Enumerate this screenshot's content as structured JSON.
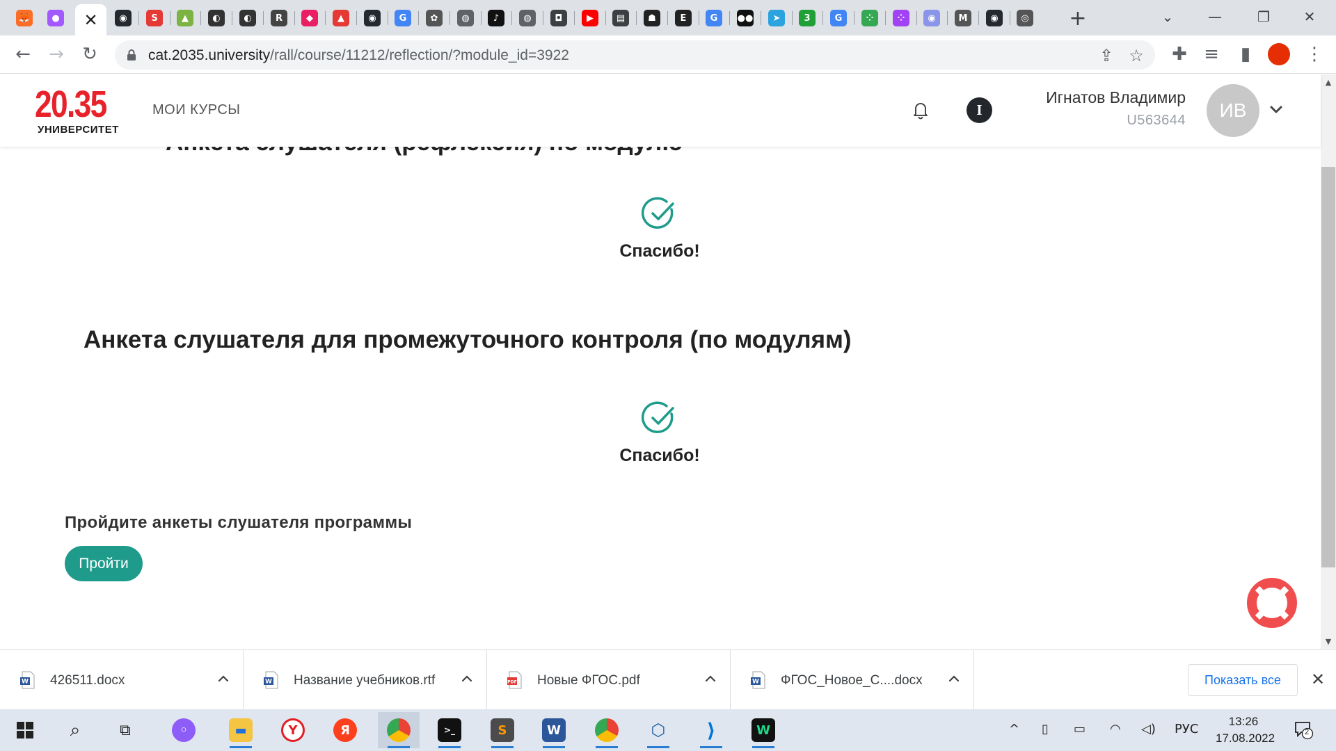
{
  "browser": {
    "tab_icons": [
      {
        "name": "gitlab-icon",
        "glyph": "🦊",
        "color": "#fc6d26"
      },
      {
        "name": "figma-icon",
        "glyph": "●",
        "color": "#a259ff"
      },
      {
        "name": "github-icon",
        "glyph": "◉",
        "color": "#24292f"
      },
      {
        "name": "s-app-icon",
        "glyph": "S",
        "color": "#e53935"
      },
      {
        "name": "leaf-icon",
        "glyph": "▲",
        "color": "#7cb342"
      },
      {
        "name": "head-icon",
        "glyph": "◐",
        "color": "#333333"
      },
      {
        "name": "head-icon-2",
        "glyph": "◐",
        "color": "#333333"
      },
      {
        "name": "r-app-icon",
        "glyph": "R",
        "color": "#444444"
      },
      {
        "name": "pink-app-icon",
        "glyph": "◆",
        "color": "#e91e63"
      },
      {
        "name": "flame-icon",
        "glyph": "▲",
        "color": "#e53935"
      },
      {
        "name": "github-icon-2",
        "glyph": "◉",
        "color": "#24292f"
      },
      {
        "name": "google-icon",
        "glyph": "G",
        "color": "#4285f4"
      },
      {
        "name": "openai-icon",
        "glyph": "✿",
        "color": "#555555"
      },
      {
        "name": "globe-icon",
        "glyph": "◍",
        "color": "#5f6368"
      },
      {
        "name": "tiktok-icon",
        "glyph": "♪",
        "color": "#111111"
      },
      {
        "name": "globe-icon-2",
        "glyph": "◍",
        "color": "#5f6368"
      },
      {
        "name": "app-icon",
        "glyph": "◘",
        "color": "#3c4043"
      },
      {
        "name": "youtube-icon",
        "glyph": "▶",
        "color": "#ff0000"
      },
      {
        "name": "book-icon",
        "glyph": "▤",
        "color": "#3c4043"
      },
      {
        "name": "ghost-icon",
        "glyph": "☗",
        "color": "#222222"
      },
      {
        "name": "e-app-icon",
        "glyph": "E",
        "color": "#222222"
      },
      {
        "name": "google-icon-2",
        "glyph": "G",
        "color": "#4285f4"
      },
      {
        "name": "medium-icon",
        "glyph": "●●",
        "color": "#111111"
      },
      {
        "name": "telegram-icon",
        "glyph": "➤",
        "color": "#2aa3df"
      },
      {
        "name": "three-icon",
        "glyph": "3",
        "color": "#21a038"
      },
      {
        "name": "google-icon-3",
        "glyph": "G",
        "color": "#4285f4"
      },
      {
        "name": "dots-icon",
        "glyph": "⁘",
        "color": "#34a853"
      },
      {
        "name": "dots-icon-2",
        "glyph": "⁘",
        "color": "#a142f4"
      },
      {
        "name": "chat-icon",
        "glyph": "◉",
        "color": "#8a94e8"
      },
      {
        "name": "gmail-icon",
        "glyph": "M",
        "color": "#555555"
      },
      {
        "name": "github-icon-3",
        "glyph": "◉",
        "color": "#24292f"
      },
      {
        "name": "chrome-icon",
        "glyph": "◎",
        "color": "#555555"
      }
    ],
    "active_tab_close": "✕",
    "new_tab": "+",
    "url_host": "cat.2035.university",
    "url_path": "/rall/course/11212/reflection/?module_id=3922"
  },
  "header": {
    "logo_number": "20.35",
    "logo_text": "УНИВЕРСИТЕТ",
    "nav_courses": "МОИ КУРСЫ",
    "info_letter": "I",
    "user_name": "Игнатов Владимир",
    "user_id": "U563644",
    "avatar_initials": "ИВ"
  },
  "content": {
    "cut_heading": "Анкета слушателя (рефлексия) по модулю",
    "thanks_1": "Спасибо!",
    "survey_title": "Анкета слушателя для промежуточного контроля (по модулям)",
    "thanks_2": "Спасибо!",
    "prompt": "Пройдите анкеты слушателя программы",
    "go_button": "Пройти",
    "accent_color": "#1f9b8b"
  },
  "downloads": {
    "items": [
      {
        "name": "426511.docx",
        "type": "word"
      },
      {
        "name": "Название учебников.rtf",
        "type": "word"
      },
      {
        "name": "Новые ФГОС.pdf",
        "type": "pdf"
      },
      {
        "name": "ФГОС_Новое_С....docx",
        "type": "word"
      }
    ],
    "show_all": "Показать все"
  },
  "taskbar": {
    "language": "РУС",
    "time": "13:26",
    "date": "17.08.2022",
    "notifications": "2"
  }
}
